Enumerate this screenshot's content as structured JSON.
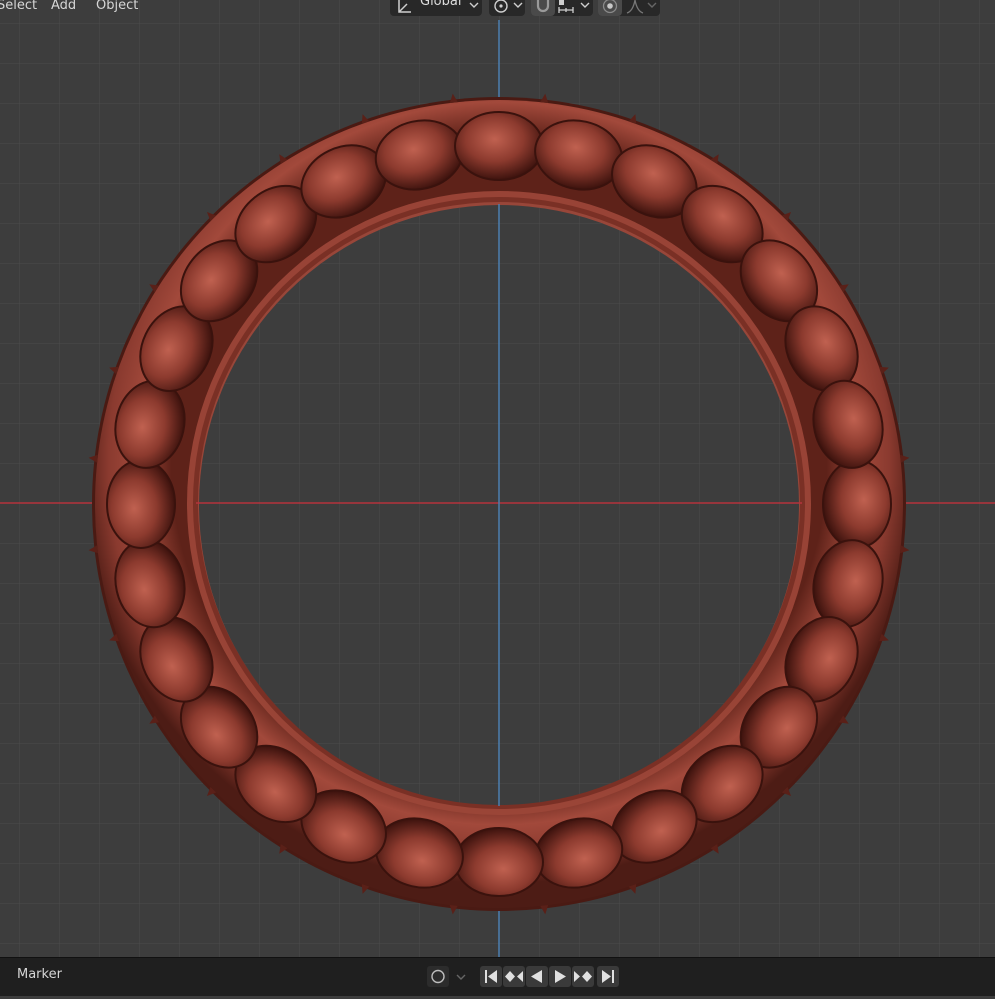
{
  "header": {
    "menu": [
      "Select",
      "Add",
      "Object"
    ],
    "transform_orientation": "Global"
  },
  "timeline": {
    "label": "Marker"
  },
  "colors": {
    "viewport_bg": "#3d3d3d",
    "grid": "#4b4b4b",
    "x_axis": "#b5333d",
    "y_axis": "#4c7fb0",
    "ring": "#8b3e33"
  },
  "icons": {
    "orientation": "transform-orientation-icon",
    "pivot": "pivot-point-icon",
    "snap": "snap-magnet-icon",
    "snap_target": "snap-increment-icon",
    "proportional": "proportional-editing-icon",
    "falloff": "falloff-curve-icon",
    "record": "record-icon",
    "jump_start": "jump-to-start-icon",
    "prev_key": "previous-keyframe-icon",
    "play_reverse": "play-reverse-icon",
    "play": "play-icon",
    "next_key": "next-keyframe-icon",
    "jump_end": "jump-to-end-icon"
  }
}
